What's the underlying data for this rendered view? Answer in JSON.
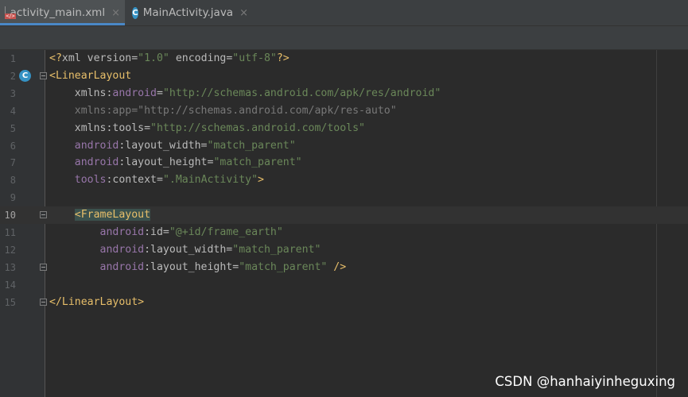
{
  "tabs": [
    {
      "label": "activity_main.xml",
      "icon": "xml-file-icon",
      "icon_text": "</>",
      "close": "×",
      "active": true
    },
    {
      "label": "MainActivity.java",
      "icon": "java-class-icon",
      "icon_text": "C",
      "close": "×",
      "active": false
    }
  ],
  "gutter_marker_text": "C",
  "current_line": 10,
  "lines": [
    {
      "num": "1",
      "tokens": [
        [
          "p",
          "<?"
        ],
        [
          "a",
          "xml version="
        ],
        [
          "v",
          "\"1.0\""
        ],
        [
          "a",
          " encoding="
        ],
        [
          "v",
          "\"utf-8\""
        ],
        [
          "p",
          "?>"
        ]
      ]
    },
    {
      "num": "2",
      "tokens": [
        [
          "p",
          "<"
        ],
        [
          "t",
          "LinearLayout"
        ]
      ],
      "fold": true,
      "marker": true
    },
    {
      "num": "3",
      "tokens": [
        [
          "a",
          "    xmlns:"
        ],
        [
          "n",
          "android"
        ],
        [
          "a",
          "="
        ],
        [
          "v",
          "\"http://schemas.android.com/apk/res/android\""
        ]
      ]
    },
    {
      "num": "4",
      "tokens": [
        [
          "d",
          "    xmlns:app=\"http://schemas.android.com/apk/res-auto\""
        ]
      ]
    },
    {
      "num": "5",
      "tokens": [
        [
          "a",
          "    xmlns:tools="
        ],
        [
          "v",
          "\"http://schemas.android.com/tools\""
        ]
      ]
    },
    {
      "num": "6",
      "tokens": [
        [
          "n",
          "    android"
        ],
        [
          "a",
          ":layout_width="
        ],
        [
          "v",
          "\"match_parent\""
        ]
      ]
    },
    {
      "num": "7",
      "tokens": [
        [
          "n",
          "    android"
        ],
        [
          "a",
          ":layout_height="
        ],
        [
          "v",
          "\"match_parent\""
        ]
      ]
    },
    {
      "num": "8",
      "tokens": [
        [
          "n",
          "    tools"
        ],
        [
          "a",
          ":context="
        ],
        [
          "v",
          "\".MainActivity\""
        ],
        [
          "p",
          ">"
        ]
      ]
    },
    {
      "num": "9",
      "tokens": []
    },
    {
      "num": "10",
      "tokens": [
        [
          "a",
          "    "
        ],
        [
          "h",
          "<"
        ],
        [
          "th",
          "FrameLayout"
        ]
      ],
      "fold": true
    },
    {
      "num": "11",
      "tokens": [
        [
          "n",
          "        android"
        ],
        [
          "a",
          ":id="
        ],
        [
          "v",
          "\"@+id/frame_earth\""
        ]
      ]
    },
    {
      "num": "12",
      "tokens": [
        [
          "n",
          "        android"
        ],
        [
          "a",
          ":layout_width="
        ],
        [
          "v",
          "\"match_parent\""
        ]
      ]
    },
    {
      "num": "13",
      "tokens": [
        [
          "n",
          "        android"
        ],
        [
          "a",
          ":layout_height="
        ],
        [
          "v",
          "\"match_parent\""
        ],
        [
          "p",
          " />"
        ]
      ],
      "fold": true
    },
    {
      "num": "14",
      "tokens": []
    },
    {
      "num": "15",
      "tokens": [
        [
          "p",
          "</"
        ],
        [
          "t",
          "LinearLayout"
        ],
        [
          "p",
          ">"
        ]
      ],
      "fold": true
    }
  ],
  "watermark": "CSDN @hanhaiyinheguxing",
  "colors": {
    "background": "#2b2b2b",
    "tag": "#e8bf6a",
    "namespace": "#9876aa",
    "string": "#6a8759",
    "attribute": "#bababa",
    "tab_accent": "#4a88c7"
  }
}
